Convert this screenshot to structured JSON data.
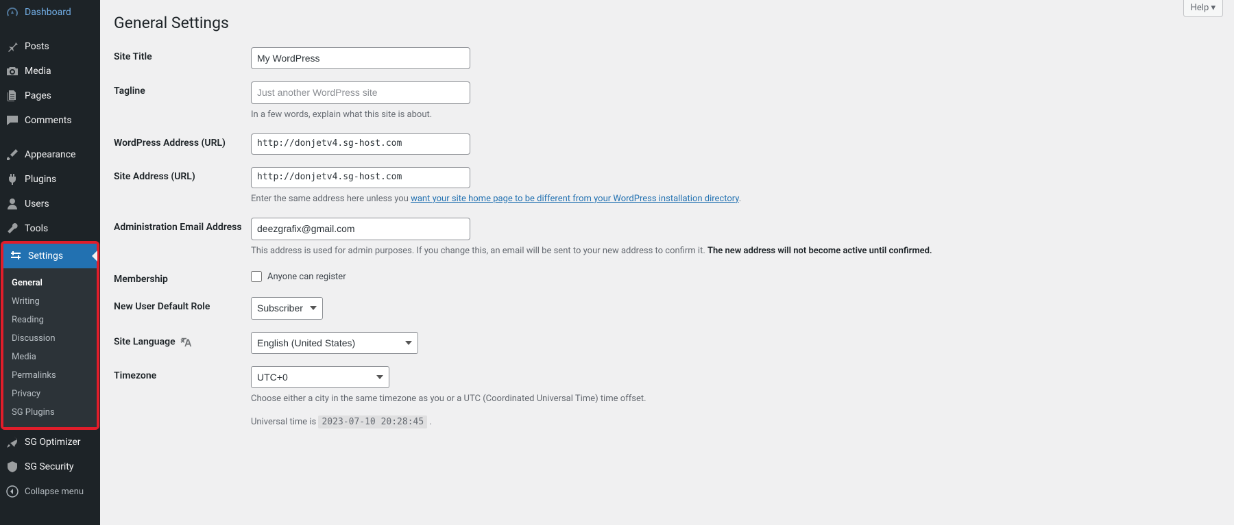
{
  "help_label": "Help ▾",
  "page_title": "General Settings",
  "sidebar": [
    {
      "name": "dashboard",
      "label": "Dashboard",
      "icon": "speedometer"
    },
    {
      "sep": true
    },
    {
      "name": "posts",
      "label": "Posts",
      "icon": "pin"
    },
    {
      "name": "media",
      "label": "Media",
      "icon": "camera"
    },
    {
      "name": "pages",
      "label": "Pages",
      "icon": "pages"
    },
    {
      "name": "comments",
      "label": "Comments",
      "icon": "chat"
    },
    {
      "sep": true
    },
    {
      "name": "appearance",
      "label": "Appearance",
      "icon": "brush"
    },
    {
      "name": "plugins",
      "label": "Plugins",
      "icon": "plug"
    },
    {
      "name": "users",
      "label": "Users",
      "icon": "user"
    },
    {
      "name": "tools",
      "label": "Tools",
      "icon": "wrench"
    }
  ],
  "settings_item": {
    "label": "Settings",
    "icon": "sliders"
  },
  "settings_submenu": [
    {
      "name": "general",
      "label": "General",
      "active": true
    },
    {
      "name": "writing",
      "label": "Writing"
    },
    {
      "name": "reading",
      "label": "Reading"
    },
    {
      "name": "discussion",
      "label": "Discussion"
    },
    {
      "name": "media",
      "label": "Media"
    },
    {
      "name": "permalinks",
      "label": "Permalinks"
    },
    {
      "name": "privacy",
      "label": "Privacy"
    },
    {
      "name": "sg-plugins",
      "label": "SG Plugins"
    }
  ],
  "sidebar_after": [
    {
      "name": "sg-optimizer",
      "label": "SG Optimizer",
      "icon": "rocket"
    },
    {
      "name": "sg-security",
      "label": "SG Security",
      "icon": "shield"
    }
  ],
  "collapse_label": "Collapse menu",
  "fields": {
    "site_title": {
      "label": "Site Title",
      "value": "My WordPress"
    },
    "tagline": {
      "label": "Tagline",
      "placeholder": "Just another WordPress site",
      "desc": "In a few words, explain what this site is about."
    },
    "wp_url": {
      "label": "WordPress Address (URL)",
      "value": "http://donjetv4.sg-host.com"
    },
    "site_url": {
      "label": "Site Address (URL)",
      "value": "http://donjetv4.sg-host.com",
      "desc_before": "Enter the same address here unless you ",
      "desc_link": "want your site home page to be different from your WordPress installation directory",
      "desc_after": "."
    },
    "admin_email": {
      "label": "Administration Email Address",
      "value": "deezgrafix@gmail.com",
      "desc_before": "This address is used for admin purposes. If you change this, an email will be sent to your new address to confirm it. ",
      "desc_strong": "The new address will not become active until confirmed."
    },
    "membership": {
      "label": "Membership",
      "checkbox_label": "Anyone can register"
    },
    "default_role": {
      "label": "New User Default Role",
      "value": "Subscriber"
    },
    "site_language": {
      "label": "Site Language",
      "value": "English (United States)"
    },
    "timezone": {
      "label": "Timezone",
      "value": "UTC+0",
      "desc": "Choose either a city in the same timezone as you or a UTC (Coordinated Universal Time) time offset.",
      "universal_before": "Universal time is ",
      "universal_code": "2023-07-10 20:28:45",
      "universal_after": " ."
    }
  }
}
